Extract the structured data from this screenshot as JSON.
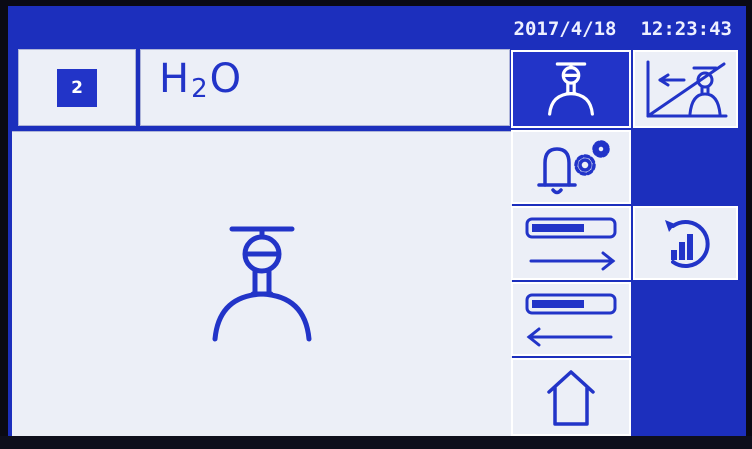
{
  "status": {
    "date": "2017/4/18",
    "time": "12:23:43"
  },
  "channel": {
    "number": "2"
  },
  "medium": {
    "pre": "H",
    "sub": "2",
    "post": "O"
  },
  "colors": {
    "screen_bg": "#1c2fbd",
    "panel_bg": "#eceff7",
    "accent": "#2234c8",
    "text_light": "#ffffff"
  },
  "icons": {
    "main_graphic": "diaphragm-valve-icon",
    "valve_button": "diaphragm-valve-icon",
    "calibration_button": "valve-curve-icon",
    "alarm_settings_button": "bell-gears-icon",
    "progress_forward_button": "progress-arrow-right-icon",
    "progress_back_button": "progress-arrow-left-icon",
    "home_button": "home-icon",
    "statistics_reset_button": "bar-chart-reset-icon"
  }
}
